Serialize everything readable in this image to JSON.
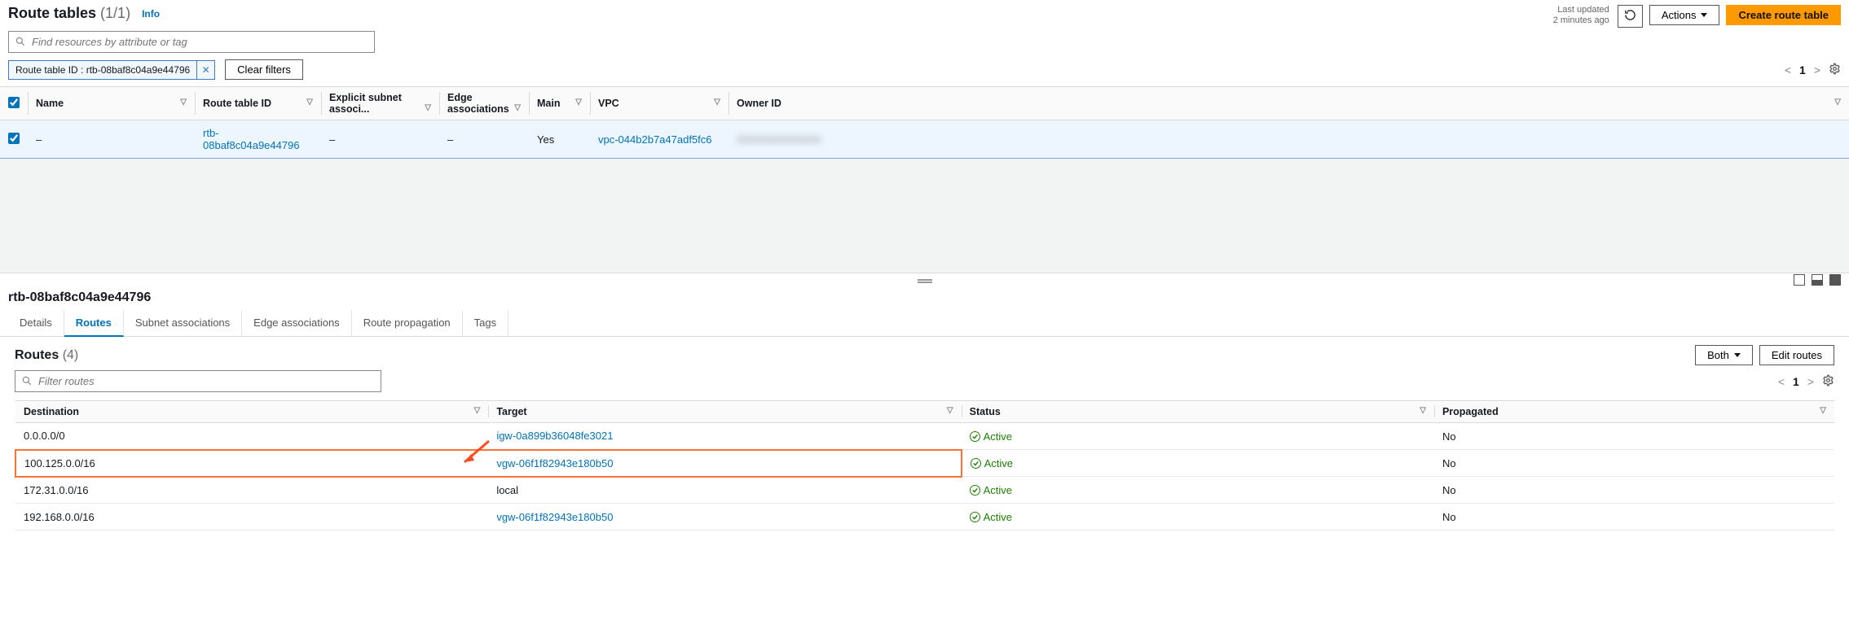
{
  "header": {
    "title": "Route tables",
    "count": "(1/1)",
    "info": "Info",
    "last_updated_label": "Last updated",
    "last_updated_value": "2 minutes ago",
    "actions_label": "Actions",
    "create_label": "Create route table"
  },
  "filters": {
    "placeholder": "Find resources by attribute or tag",
    "chip_prefix": "Route table ID : ",
    "chip_value": "rtb-08baf8c04a9e44796",
    "clear_label": "Clear filters",
    "page_no": "1"
  },
  "top_table": {
    "cols": {
      "name": "Name",
      "rtid": "Route table ID",
      "subnet": "Explicit subnet associ...",
      "edge": "Edge associations",
      "main": "Main",
      "vpc": "VPC",
      "owner": "Owner ID"
    },
    "row": {
      "name": "–",
      "rtid": "rtb-08baf8c04a9e44796",
      "subnet": "–",
      "edge": "–",
      "main": "Yes",
      "vpc": "vpc-044b2b7a47adf5fc6",
      "owner": "XXXXXXXXXXXX"
    }
  },
  "detail": {
    "title": "rtb-08baf8c04a9e44796",
    "tabs": {
      "details": "Details",
      "routes": "Routes",
      "subnet": "Subnet associations",
      "edge": "Edge associations",
      "prop": "Route propagation",
      "tags": "Tags"
    },
    "routes_header": {
      "title": "Routes",
      "count": "(4)",
      "both_label": "Both",
      "edit_label": "Edit routes",
      "filter_placeholder": "Filter routes",
      "page_no": "1"
    },
    "route_cols": {
      "dest": "Destination",
      "target": "Target",
      "status": "Status",
      "prop": "Propagated"
    },
    "routes": [
      {
        "dest": "0.0.0.0/0",
        "target": "igw-0a899b36048fe3021",
        "target_link": true,
        "status": "Active",
        "prop": "No"
      },
      {
        "dest": "100.125.0.0/16",
        "target": "vgw-06f1f82943e180b50",
        "target_link": true,
        "status": "Active",
        "prop": "No"
      },
      {
        "dest": "172.31.0.0/16",
        "target": "local",
        "target_link": false,
        "status": "Active",
        "prop": "No"
      },
      {
        "dest": "192.168.0.0/16",
        "target": "vgw-06f1f82943e180b50",
        "target_link": true,
        "status": "Active",
        "prop": "No"
      }
    ]
  }
}
